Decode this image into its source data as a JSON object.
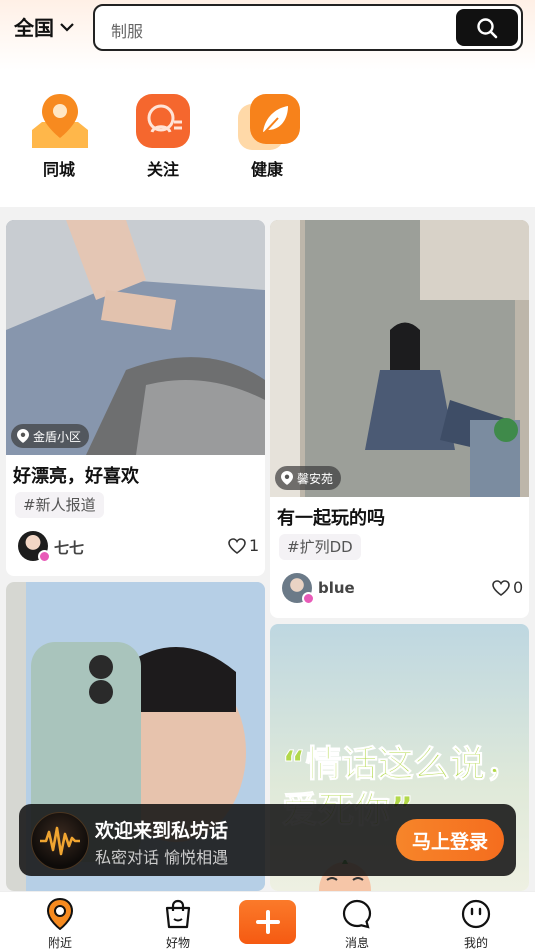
{
  "header": {
    "region": "全国",
    "search_placeholder": "制服"
  },
  "categories": [
    {
      "label": "同城",
      "icon": "location-pin-icon"
    },
    {
      "label": "关注",
      "icon": "follow-icon"
    },
    {
      "label": "健康",
      "icon": "leaf-icon"
    }
  ],
  "feed": [
    {
      "location": "金盾小区",
      "title": "好漂亮，好喜欢",
      "tag": "#新人报道",
      "user": "七七",
      "likes": "1"
    },
    {
      "location": "馨安苑",
      "title": "有一起玩的吗",
      "tag": "#扩列DD",
      "user": "blue",
      "likes": "0"
    },
    {
      "overlay_text": "“情话这么说，爱死你”"
    }
  ],
  "login_banner": {
    "title": "欢迎来到私坊话",
    "subtitle": "私密对话 愉悦相遇",
    "button": "马上登录"
  },
  "nav": [
    {
      "label": "附近",
      "icon": "nearby-pin-icon"
    },
    {
      "label": "好物",
      "icon": "shopping-bag-icon"
    },
    {
      "label": "",
      "icon": "plus-icon"
    },
    {
      "label": "消息",
      "icon": "message-bubble-icon"
    },
    {
      "label": "我的",
      "icon": "profile-face-icon"
    }
  ],
  "colors": {
    "accent": "#f56d1e",
    "badge": "#e85bb8"
  }
}
